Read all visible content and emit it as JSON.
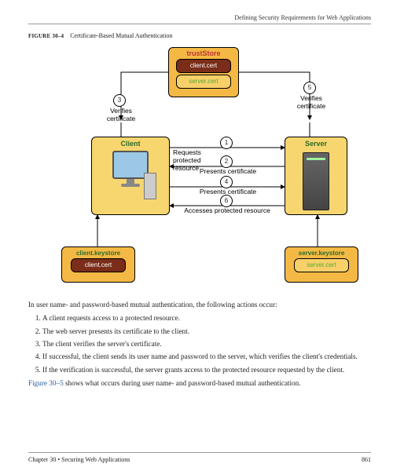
{
  "header": {
    "running_head": "Defining Security Requirements for Web Applications"
  },
  "figure": {
    "label": "FIGURE 30–4",
    "caption": "Certificate-Based Mutual Authentication"
  },
  "diagram": {
    "truststore": {
      "title": "trustStore",
      "cert1": "client.cert",
      "cert2": "server.cert"
    },
    "client": {
      "title": "Client"
    },
    "server": {
      "title": "Server"
    },
    "client_keystore": {
      "title": "client.keystore",
      "cert": "client.cert"
    },
    "server_keystore": {
      "title": "server.keystore",
      "cert": "server.cert"
    },
    "verify_left": "Verifies\ncertificate",
    "verify_right": "Verifies\ncertificate",
    "steps": {
      "n1": "1",
      "t1": "Requests protected resource",
      "n2": "2",
      "t2": "Presents certificate",
      "n3": "3",
      "n4": "4",
      "t4": "Presents certificate",
      "n5": "5",
      "n6": "6",
      "t6": "Accesses protected resource"
    }
  },
  "body": {
    "intro": "In user name- and password-based mutual authentication, the following actions occur:",
    "items": [
      "A client requests access to a protected resource.",
      "The web server presents its certificate to the client.",
      "The client verifies the server's certificate.",
      "If successful, the client sends its user name and password to the server, which verifies the client's credentials.",
      "If the verification is successful, the server grants access to the protected resource requested by the client."
    ],
    "link_sentence_prefix": "Figure 30–5",
    "link_sentence_rest": " shows what occurs during user name- and password-based mutual authentication."
  },
  "footer": {
    "left": "Chapter 30 • Securing Web Applications",
    "right": "861"
  }
}
